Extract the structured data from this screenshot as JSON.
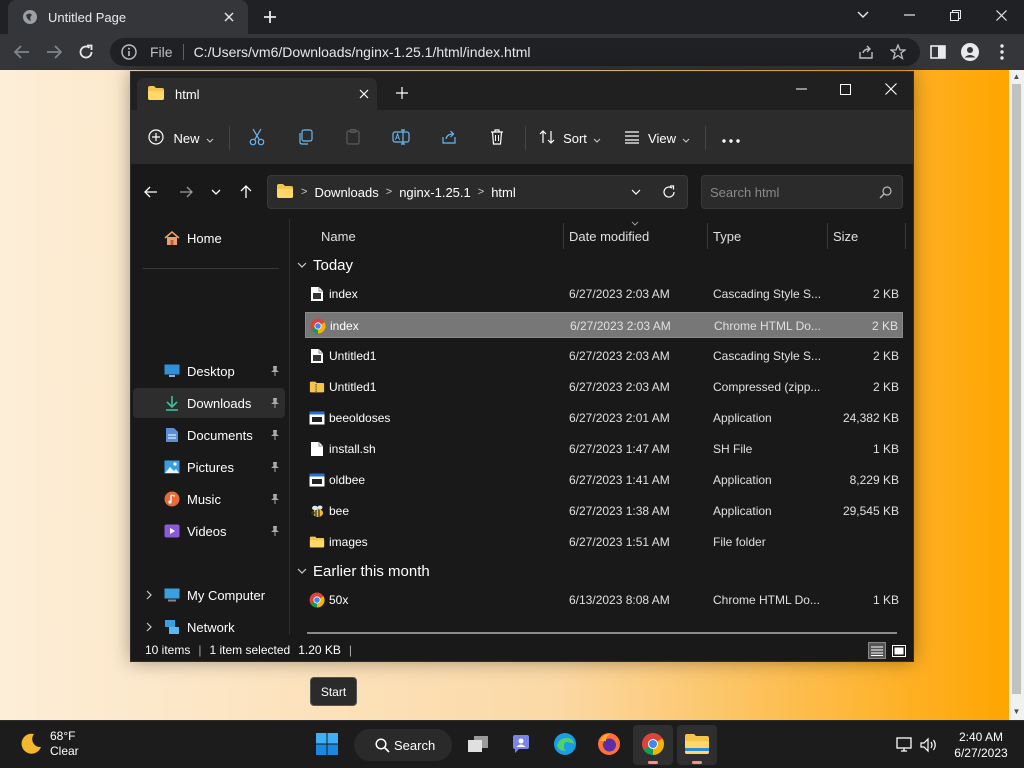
{
  "browser": {
    "tab_title": "Untitled Page",
    "url_scheme": "File",
    "url": "C:/Users/vm6/Downloads/nginx-1.25.1/html/index.html"
  },
  "tooltip": {
    "text": "Start"
  },
  "explorer": {
    "tab_title": "html",
    "commands": {
      "new_label": "New",
      "sort_label": "Sort",
      "view_label": "View"
    },
    "breadcrumb": [
      "Downloads",
      "nginx-1.25.1",
      "html"
    ],
    "search_placeholder": "Search html",
    "nav": {
      "home": "Home",
      "desktop": "Desktop",
      "downloads": "Downloads",
      "documents": "Documents",
      "pictures": "Pictures",
      "music": "Music",
      "videos": "Videos",
      "my_computer": "My Computer",
      "network": "Network"
    },
    "columns": {
      "name": "Name",
      "date": "Date modified",
      "type": "Type",
      "size": "Size"
    },
    "groups": {
      "today": "Today",
      "earlier": "Earlier this month"
    },
    "files": [
      {
        "name": "index",
        "date": "6/27/2023 2:03 AM",
        "type": "Cascading Style S...",
        "size": "2 KB",
        "icon": "css-file-icon"
      },
      {
        "name": "index",
        "date": "6/27/2023 2:03 AM",
        "type": "Chrome HTML Do...",
        "size": "2 KB",
        "icon": "chrome-file-icon",
        "selected": true
      },
      {
        "name": "Untitled1",
        "date": "6/27/2023 2:03 AM",
        "type": "Cascading Style S...",
        "size": "2 KB",
        "icon": "css-file-icon"
      },
      {
        "name": "Untitled1",
        "date": "6/27/2023 2:03 AM",
        "type": "Compressed (zipp...",
        "size": "2 KB",
        "icon": "zip-folder-icon"
      },
      {
        "name": "beeoldoses",
        "date": "6/27/2023 2:01 AM",
        "type": "Application",
        "size": "24,382 KB",
        "icon": "application-icon"
      },
      {
        "name": "install.sh",
        "date": "6/27/2023 1:47 AM",
        "type": "SH File",
        "size": "1 KB",
        "icon": "blank-file-icon"
      },
      {
        "name": "oldbee",
        "date": "6/27/2023 1:41 AM",
        "type": "Application",
        "size": "8,229 KB",
        "icon": "application-icon"
      },
      {
        "name": "bee",
        "date": "6/27/2023 1:38 AM",
        "type": "Application",
        "size": "29,545 KB",
        "icon": "bee-app-icon"
      },
      {
        "name": "images",
        "date": "6/27/2023 1:51 AM",
        "type": "File folder",
        "size": "",
        "icon": "folder-icon"
      },
      {
        "name": "50x",
        "date": "6/13/2023 8:08 AM",
        "type": "Chrome HTML Do...",
        "size": "1 KB",
        "icon": "chrome-file-icon"
      }
    ],
    "status": {
      "count": "10 items",
      "selection": "1 item selected",
      "size": "1.20 KB"
    }
  },
  "taskbar": {
    "weather_temp": "68°F",
    "weather_desc": "Clear",
    "search_label": "Search",
    "time": "2:40 AM",
    "date": "6/27/2023"
  }
}
